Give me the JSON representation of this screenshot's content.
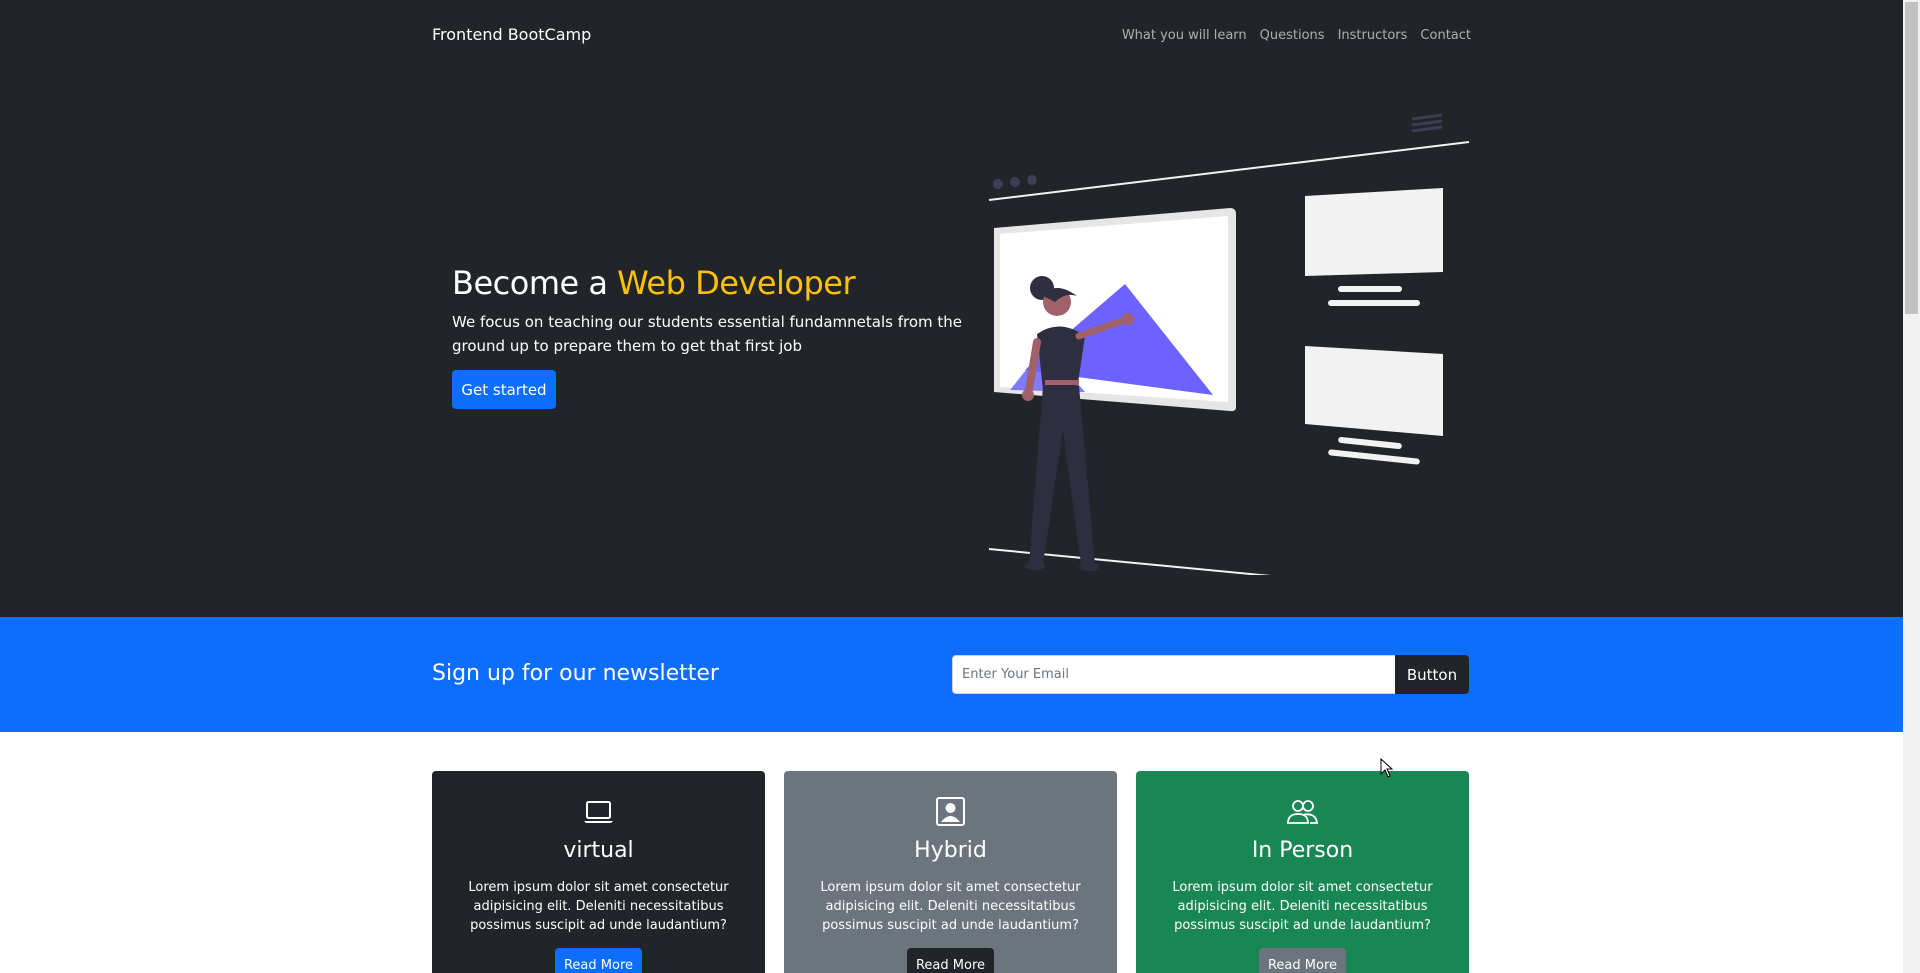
{
  "navbar": {
    "brand": "Frontend BootCamp",
    "links": [
      {
        "label": "What you will learn"
      },
      {
        "label": "Questions"
      },
      {
        "label": "Instructors"
      },
      {
        "label": "Contact"
      }
    ]
  },
  "hero": {
    "title_prefix": "Become a ",
    "title_accent": "Web Developer",
    "description": "We focus on teaching our students essential fundamnetals from the ground up to prepare them to get that first job",
    "cta_label": "Get started"
  },
  "newsletter": {
    "title": "Sign up for our newsletter",
    "email_placeholder": "Enter Your Email",
    "button_label": "Button"
  },
  "cards": [
    {
      "icon": "laptop-icon",
      "title": "virtual",
      "text": "Lorem ipsum dolor sit amet consectetur adipisicing elit. Deleniti necessitatibus possimus suscipit ad unde laudantium?",
      "button": "Read More"
    },
    {
      "icon": "person-badge-icon",
      "title": "Hybrid",
      "text": "Lorem ipsum dolor sit amet consectetur adipisicing elit. Deleniti necessitatibus possimus suscipit ad unde laudantium?",
      "button": "Read More"
    },
    {
      "icon": "people-icon",
      "title": "In Person",
      "text": "Lorem ipsum dolor sit amet consectetur adipisicing elit. Deleniti necessitatibus possimus suscipit ad unde laudantium?",
      "button": "Read More"
    }
  ],
  "colors": {
    "dark": "#212529",
    "primary": "#0d6efd",
    "accent": "#ffc107",
    "secondary": "#6c757d",
    "success": "#198754",
    "illustration_purple": "#6c63ff"
  }
}
